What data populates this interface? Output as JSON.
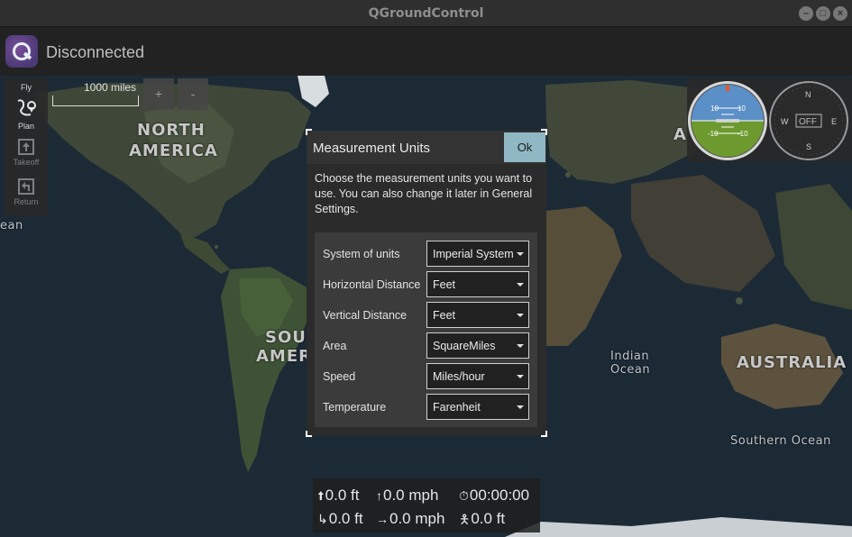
{
  "window": {
    "title": "QGroundControl",
    "controls": {
      "minimize": "–",
      "maximize": "□",
      "close": "×"
    }
  },
  "toolbar": {
    "logo_icon": "qgc-logo-icon",
    "status": "Disconnected"
  },
  "toolstrip": {
    "items": [
      {
        "label": "Fly",
        "icon": "fly-icon",
        "enabled": true
      },
      {
        "label": "Plan",
        "icon": "plan-icon",
        "enabled": true
      },
      {
        "label": "Takeoff",
        "icon": "takeoff-icon",
        "enabled": false
      },
      {
        "label": "Return",
        "icon": "return-icon",
        "enabled": false
      }
    ]
  },
  "map": {
    "scale_label": "1000 miles",
    "zoom_in": "+",
    "zoom_out": "-",
    "labels": {
      "north_america_1": "NORTH",
      "north_america_2": "AMERICA",
      "south_america_1": "SOUT",
      "south_america_2": "AMER",
      "asia_fragment": "A",
      "australia": "AUSTRALIA",
      "indian_ocean_1": "Indian",
      "indian_ocean_2": "Ocean",
      "southern_ocean": "Southern Ocean",
      "ocean_fragment": "ean"
    }
  },
  "instruments": {
    "attitude": {
      "pitch_upper_left": "10",
      "pitch_upper_right": "10",
      "pitch_lower_left": "-10",
      "pitch_lower_right": "-10"
    },
    "compass": {
      "north": "N",
      "south": "S",
      "east": "E",
      "west": "W",
      "status": "OFF"
    }
  },
  "dialog": {
    "title": "Measurement Units",
    "ok_label": "Ok",
    "description": "Choose the measurement units you want to use. You can also change it later in General Settings.",
    "rows": [
      {
        "label": "System of units",
        "value": "Imperial System"
      },
      {
        "label": "Horizontal Distance",
        "value": "Feet"
      },
      {
        "label": "Vertical Distance",
        "value": "Feet"
      },
      {
        "label": "Area",
        "value": "SquareMiles"
      },
      {
        "label": "Speed",
        "value": "Miles/hour"
      },
      {
        "label": "Temperature",
        "value": "Farenheit"
      }
    ]
  },
  "telemetry": {
    "altitude": "0.0 ft",
    "climb_rate": "0.0 mph",
    "flight_time": "00:00:00",
    "distance": "0.0 ft",
    "ground_speed": "0.0 mph",
    "home_distance": "0.0 ft"
  },
  "colors": {
    "ok_button": "#8fb8c4",
    "attitude_sky": "#5b8fc8",
    "attitude_ground": "#6c9a2e",
    "attitude_marker": "#e05a2b"
  }
}
